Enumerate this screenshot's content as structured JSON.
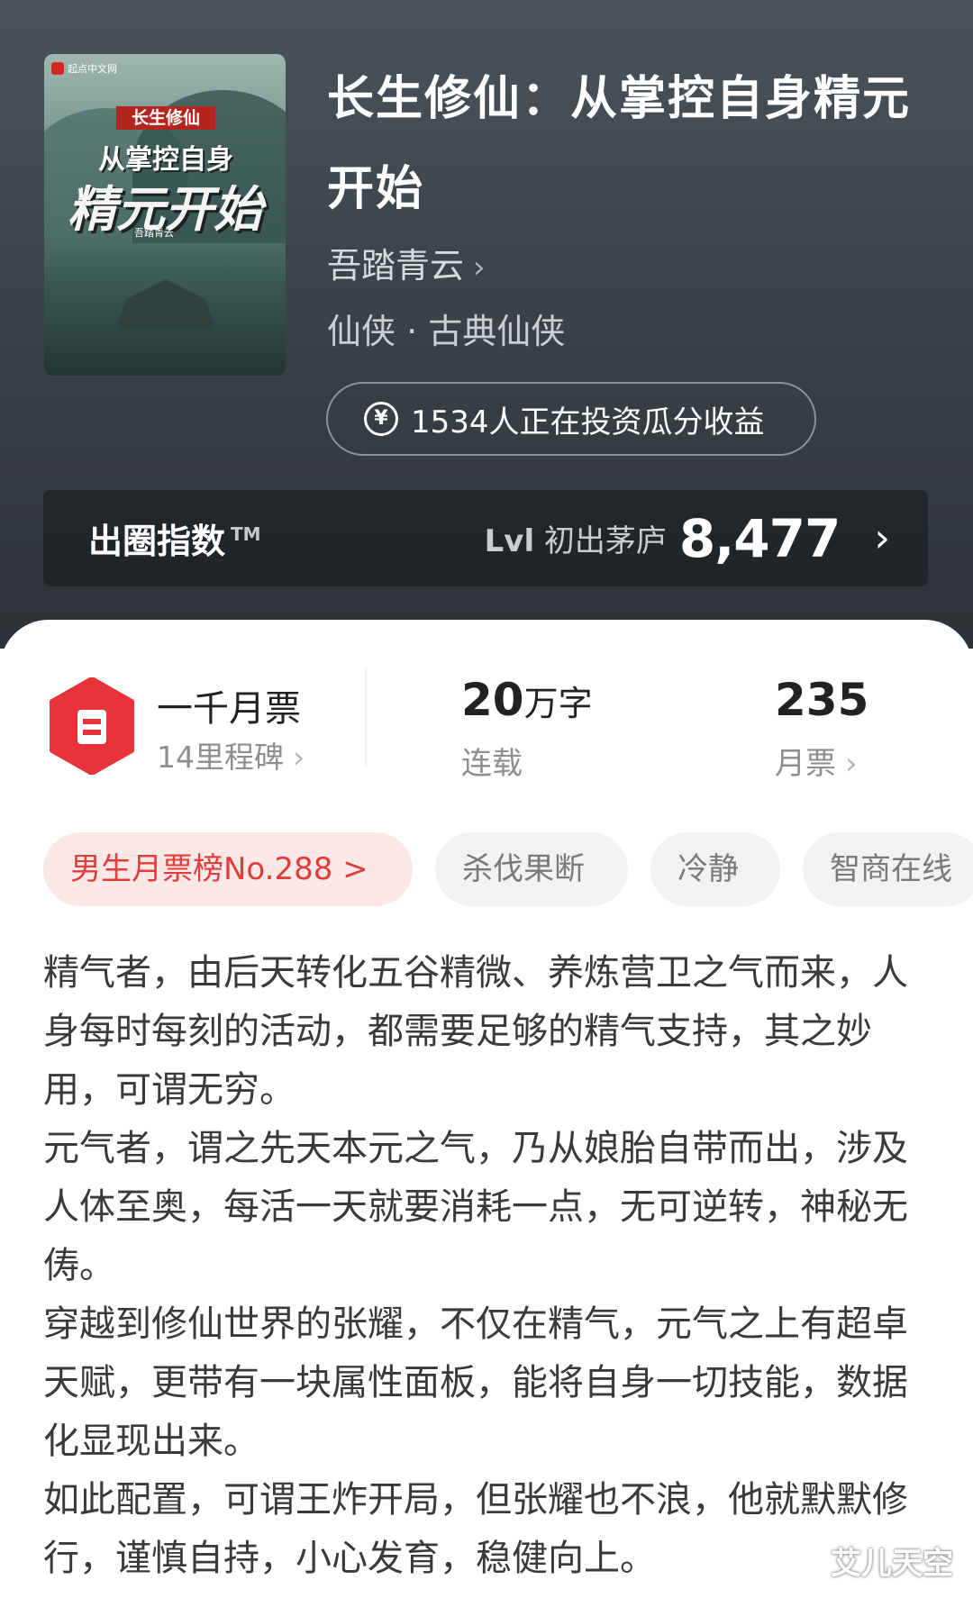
{
  "book": {
    "cover": {
      "publisher": "起点中文网",
      "series_tag": "长生修仙",
      "line1": "从掌控自身",
      "line2": "精元开始",
      "author": "吾踏青云"
    },
    "title": "长生修仙：从掌控自身精元开始",
    "author": "吾踏青云",
    "genre": "仙侠 · 古典仙侠",
    "invest_text": "1534人正在投资瓜分收益"
  },
  "index_bar": {
    "label": "出圈指数",
    "trademark": "TM",
    "level": "Lvl",
    "level_name": "初出茅庐",
    "value": "8,477"
  },
  "stats": {
    "milestone_title": "一千月票",
    "milestone_sub": "14里程碑",
    "words_number": "20",
    "words_unit": "万字",
    "status": "连载",
    "votes_number": "235",
    "votes_label": "月票"
  },
  "tags": [
    "男生月票榜No.288 >",
    "杀伐果断",
    "冷静",
    "智商在线"
  ],
  "description": [
    "精气者，由后天转化五谷精微、养炼营卫之气而来，人身每时每刻的活动，都需要足够的精气支持，其之妙用，可谓无穷。",
    "元气者，谓之先天本元之气，乃从娘胎自带而出，涉及人体至奥，每活一天就要消耗一点，无可逆转，神秘无俦。",
    "穿越到修仙世界的张耀，不仅在精气，元气之上有超卓天赋，更带有一块属性面板，能将自身一切技能，数据化显现出来。",
    "如此配置，可谓王炸开局，但张耀也不浪，他就默默修行，谨慎自持，小心发育，稳健向上。"
  ],
  "watermark": "艾儿天空",
  "colors": {
    "accent_red": "#e8333a",
    "rank_tag_bg": "#fde8e8",
    "header_bg": "#3b434a"
  },
  "icons": {
    "yen": "yen-coin-icon",
    "ticket": "ticket-badge-icon",
    "chevron": "chevron-right-icon"
  }
}
